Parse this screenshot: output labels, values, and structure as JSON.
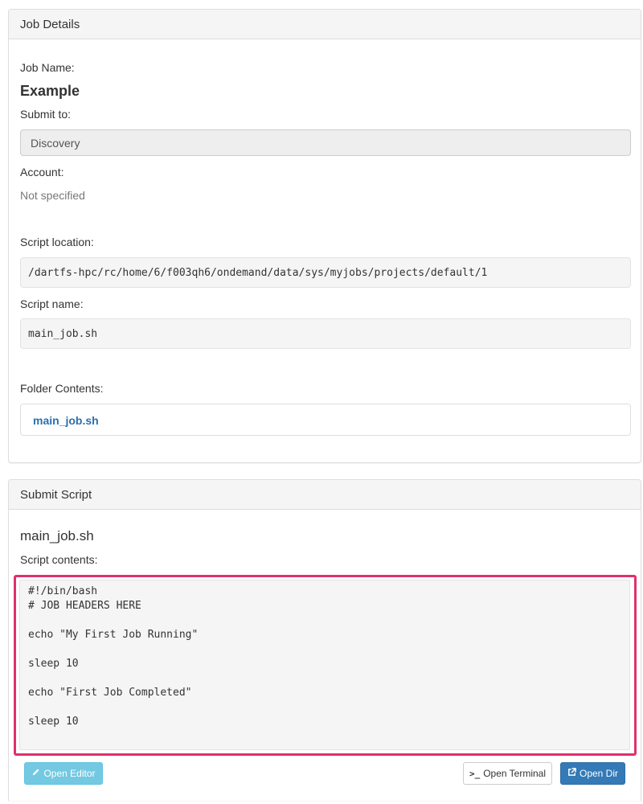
{
  "job_details": {
    "heading": "Job Details",
    "job_name_label": "Job Name:",
    "job_name": "Example",
    "submit_to_label": "Submit to:",
    "submit_to_value": "Discovery",
    "account_label": "Account:",
    "account_value": "Not specified",
    "script_location_label": "Script location:",
    "script_location": "/dartfs-hpc/rc/home/6/f003qh6/ondemand/data/sys/myjobs/projects/default/1",
    "script_name_label": "Script name:",
    "script_name": "main_job.sh",
    "folder_contents_label": "Folder Contents:",
    "folder_contents": [
      "main_job.sh"
    ]
  },
  "submit_script": {
    "heading": "Submit Script",
    "file_title": "main_job.sh",
    "contents_label": "Script contents:",
    "contents": "#!/bin/bash\n# JOB HEADERS HERE\n\necho \"My First Job Running\"\n\nsleep 10\n\necho \"First Job Completed\"\n\nsleep 10",
    "buttons": {
      "open_editor": "Open Editor",
      "open_terminal": "Open Terminal",
      "open_dir": "Open Dir"
    }
  },
  "icons": {
    "editor": "pencil-icon",
    "terminal": "terminal-icon",
    "dir": "external-link-icon"
  },
  "colors": {
    "highlight": "#e0306e",
    "link": "#2a6fb0",
    "primary": "#337ab7",
    "info": "#5bc0de"
  }
}
